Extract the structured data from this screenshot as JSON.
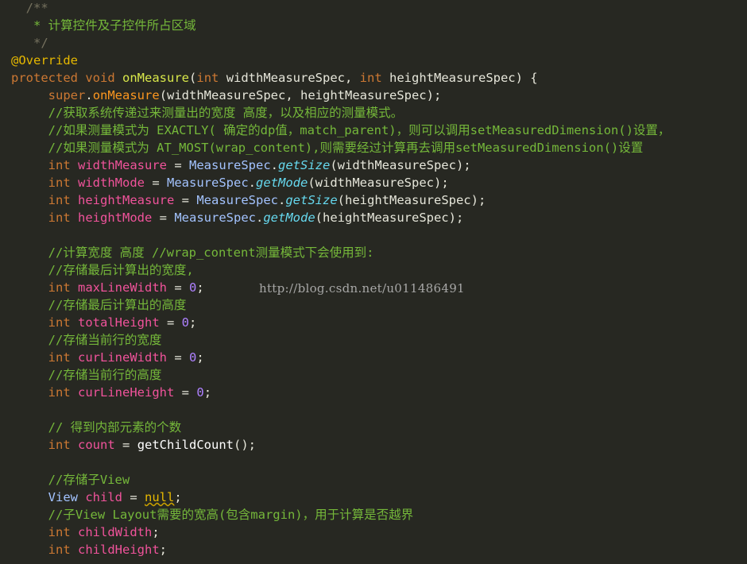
{
  "code_lines": [
    [
      {
        "t": "  /**",
        "c": "c-cmtd"
      }
    ],
    [
      {
        "t": "   * 计算控件及子控件所占区域",
        "c": "c-cmt"
      }
    ],
    [
      {
        "t": "   */",
        "c": "c-cmtd"
      }
    ],
    [
      {
        "t": "@Override",
        "c": "c-ann"
      }
    ],
    [
      {
        "t": "protected",
        "c": "c-kw"
      },
      {
        "t": " ",
        "c": "c-plain"
      },
      {
        "t": "void",
        "c": "c-kw"
      },
      {
        "t": " ",
        "c": "c-plain"
      },
      {
        "t": "onMeasure",
        "c": "c-fn"
      },
      {
        "t": "(",
        "c": "c-op"
      },
      {
        "t": "int",
        "c": "c-type"
      },
      {
        "t": " widthMeasureSpec, ",
        "c": "c-par"
      },
      {
        "t": "int",
        "c": "c-type"
      },
      {
        "t": " heightMeasureSpec) {",
        "c": "c-par"
      }
    ],
    [
      {
        "t": "     ",
        "c": "c-plain"
      },
      {
        "t": "super",
        "c": "c-sup"
      },
      {
        "t": ".",
        "c": "c-op"
      },
      {
        "t": "onMeasure",
        "c": "c-call"
      },
      {
        "t": "(widthMeasureSpec, heightMeasureSpec);",
        "c": "c-par"
      }
    ],
    [
      {
        "t": "     //获取系统传递过来测量出的宽度 高度，以及相应的测量模式。",
        "c": "c-cmt"
      }
    ],
    [
      {
        "t": "     //如果测量模式为 EXACTLY( 确定的dp值，match_parent)，则可以调用setMeasuredDimension()设置，",
        "c": "c-cmt"
      }
    ],
    [
      {
        "t": "     //如果测量模式为 AT_MOST(wrap_content),则需要经过计算再去调用setMeasuredDimension()设置",
        "c": "c-cmt"
      }
    ],
    [
      {
        "t": "     ",
        "c": "c-plain"
      },
      {
        "t": "int",
        "c": "c-type"
      },
      {
        "t": " ",
        "c": "c-plain"
      },
      {
        "t": "widthMeasure",
        "c": "c-var"
      },
      {
        "t": " = ",
        "c": "c-op"
      },
      {
        "t": "MeasureSpec",
        "c": "c-cls"
      },
      {
        "t": ".",
        "c": "c-op"
      },
      {
        "t": "getSize",
        "c": "c-meth"
      },
      {
        "t": "(widthMeasureSpec);",
        "c": "c-par"
      }
    ],
    [
      {
        "t": "     ",
        "c": "c-plain"
      },
      {
        "t": "int",
        "c": "c-type"
      },
      {
        "t": " ",
        "c": "c-plain"
      },
      {
        "t": "widthMode",
        "c": "c-var"
      },
      {
        "t": " = ",
        "c": "c-op"
      },
      {
        "t": "MeasureSpec",
        "c": "c-cls"
      },
      {
        "t": ".",
        "c": "c-op"
      },
      {
        "t": "getMode",
        "c": "c-meth"
      },
      {
        "t": "(widthMeasureSpec);",
        "c": "c-par"
      }
    ],
    [
      {
        "t": "     ",
        "c": "c-plain"
      },
      {
        "t": "int",
        "c": "c-type"
      },
      {
        "t": " ",
        "c": "c-plain"
      },
      {
        "t": "heightMeasure",
        "c": "c-var"
      },
      {
        "t": " = ",
        "c": "c-op"
      },
      {
        "t": "MeasureSpec",
        "c": "c-cls"
      },
      {
        "t": ".",
        "c": "c-op"
      },
      {
        "t": "getSize",
        "c": "c-meth"
      },
      {
        "t": "(heightMeasureSpec);",
        "c": "c-par"
      }
    ],
    [
      {
        "t": "     ",
        "c": "c-plain"
      },
      {
        "t": "int",
        "c": "c-type"
      },
      {
        "t": " ",
        "c": "c-plain"
      },
      {
        "t": "heightMode",
        "c": "c-var"
      },
      {
        "t": " = ",
        "c": "c-op"
      },
      {
        "t": "MeasureSpec",
        "c": "c-cls"
      },
      {
        "t": ".",
        "c": "c-op"
      },
      {
        "t": "getMode",
        "c": "c-meth"
      },
      {
        "t": "(heightMeasureSpec);",
        "c": "c-par"
      }
    ],
    [
      {
        "t": "",
        "c": "c-plain"
      }
    ],
    [
      {
        "t": "     //计算宽度 高度 //wrap_content测量模式下会使用到:",
        "c": "c-cmt"
      }
    ],
    [
      {
        "t": "     //存储最后计算出的宽度,",
        "c": "c-cmt"
      }
    ],
    [
      {
        "t": "     ",
        "c": "c-plain"
      },
      {
        "t": "int",
        "c": "c-type"
      },
      {
        "t": " ",
        "c": "c-plain"
      },
      {
        "t": "maxLineWidth",
        "c": "c-var"
      },
      {
        "t": " = ",
        "c": "c-op"
      },
      {
        "t": "0",
        "c": "c-num"
      },
      {
        "t": ";",
        "c": "c-op"
      }
    ],
    [
      {
        "t": "     //存储最后计算出的高度",
        "c": "c-cmt"
      }
    ],
    [
      {
        "t": "     ",
        "c": "c-plain"
      },
      {
        "t": "int",
        "c": "c-type"
      },
      {
        "t": " ",
        "c": "c-plain"
      },
      {
        "t": "totalHeight",
        "c": "c-var"
      },
      {
        "t": " = ",
        "c": "c-op"
      },
      {
        "t": "0",
        "c": "c-num"
      },
      {
        "t": ";",
        "c": "c-op"
      }
    ],
    [
      {
        "t": "     //存储当前行的宽度",
        "c": "c-cmt"
      }
    ],
    [
      {
        "t": "     ",
        "c": "c-plain"
      },
      {
        "t": "int",
        "c": "c-type"
      },
      {
        "t": " ",
        "c": "c-plain"
      },
      {
        "t": "curLineWidth",
        "c": "c-var"
      },
      {
        "t": " = ",
        "c": "c-op"
      },
      {
        "t": "0",
        "c": "c-num"
      },
      {
        "t": ";",
        "c": "c-op"
      }
    ],
    [
      {
        "t": "     //存储当前行的高度",
        "c": "c-cmt"
      }
    ],
    [
      {
        "t": "     ",
        "c": "c-plain"
      },
      {
        "t": "int",
        "c": "c-type"
      },
      {
        "t": " ",
        "c": "c-plain"
      },
      {
        "t": "curLineHeight",
        "c": "c-var"
      },
      {
        "t": " = ",
        "c": "c-op"
      },
      {
        "t": "0",
        "c": "c-num"
      },
      {
        "t": ";",
        "c": "c-op"
      }
    ],
    [
      {
        "t": "",
        "c": "c-plain"
      }
    ],
    [
      {
        "t": "     // 得到内部元素的个数",
        "c": "c-cmt"
      }
    ],
    [
      {
        "t": "     ",
        "c": "c-plain"
      },
      {
        "t": "int",
        "c": "c-type"
      },
      {
        "t": " ",
        "c": "c-plain"
      },
      {
        "t": "count",
        "c": "c-var"
      },
      {
        "t": " = ",
        "c": "c-op"
      },
      {
        "t": "getChildCount",
        "c": "c-ident"
      },
      {
        "t": "();",
        "c": "c-par"
      }
    ],
    [
      {
        "t": "",
        "c": "c-plain"
      }
    ],
    [
      {
        "t": "     //存储子View",
        "c": "c-cmt"
      }
    ],
    [
      {
        "t": "     ",
        "c": "c-plain"
      },
      {
        "t": "View",
        "c": "c-cls"
      },
      {
        "t": " ",
        "c": "c-plain"
      },
      {
        "t": "child",
        "c": "c-var"
      },
      {
        "t": " = ",
        "c": "c-op"
      },
      {
        "t": "null",
        "c": "c-null"
      },
      {
        "t": ";",
        "c": "c-op"
      }
    ],
    [
      {
        "t": "     //子View Layout需要的宽高(包含margin)，用于计算是否越界",
        "c": "c-cmt"
      }
    ],
    [
      {
        "t": "     ",
        "c": "c-plain"
      },
      {
        "t": "int",
        "c": "c-type"
      },
      {
        "t": " ",
        "c": "c-plain"
      },
      {
        "t": "childWidth",
        "c": "c-var"
      },
      {
        "t": ";",
        "c": "c-op"
      }
    ],
    [
      {
        "t": "     ",
        "c": "c-plain"
      },
      {
        "t": "int",
        "c": "c-type"
      },
      {
        "t": " ",
        "c": "c-plain"
      },
      {
        "t": "childHeight",
        "c": "c-var"
      },
      {
        "t": ";",
        "c": "c-op"
      }
    ]
  ],
  "watermark": "http://blog.csdn.net/u011486491"
}
